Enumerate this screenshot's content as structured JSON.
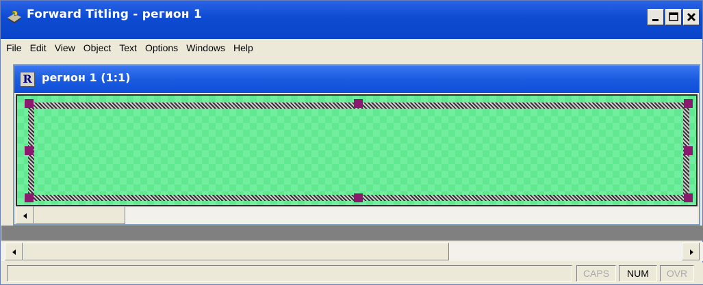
{
  "window": {
    "title": "Forward Titling - регион 1"
  },
  "menu": [
    "File",
    "Edit",
    "View",
    "Object",
    "Text",
    "Options",
    "Windows",
    "Help"
  ],
  "document": {
    "icon_letter": "R",
    "title": "регион 1  (1:1)"
  },
  "status": {
    "message": "",
    "caps": "CAPS",
    "num": "NUM",
    "ovr": "OVR"
  },
  "colors": {
    "titlebar": "#0a45c8",
    "canvas": "#63e892",
    "handle": "#8b1a6f"
  },
  "icons": {
    "app": "app-logo-icon",
    "minimize": "minimize-icon",
    "maximize": "maximize-icon",
    "close": "close-icon"
  }
}
